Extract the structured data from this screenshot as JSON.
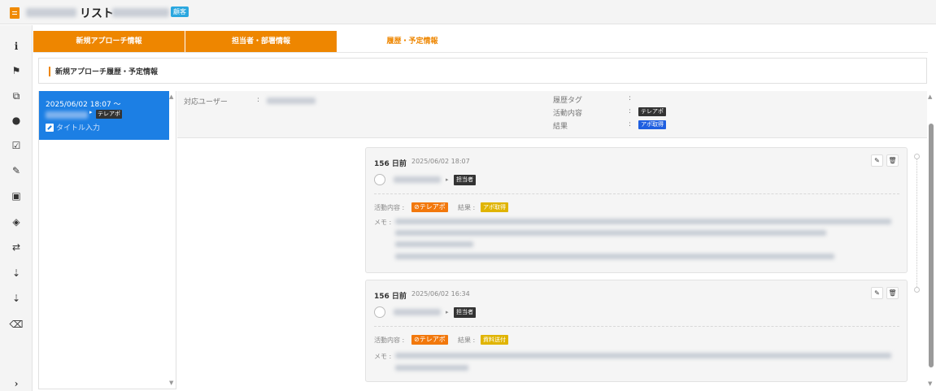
{
  "title": {
    "text": "リスト",
    "badge": "顧客"
  },
  "rail": {
    "icons": [
      "info-icon",
      "flag-icon",
      "copy-icon",
      "chat-icon",
      "checkbox-icon",
      "paperclip-icon",
      "document-icon",
      "eye-off-icon",
      "swap-icon",
      "sort-asc-icon",
      "sort-desc-icon",
      "trash-icon",
      "chevron-right-icon"
    ]
  },
  "tabs": [
    {
      "label": "新規アプローチ情報",
      "active": false
    },
    {
      "label": "担当者・部署情報",
      "active": false
    },
    {
      "label": "履歴・予定情報",
      "active": true
    }
  ],
  "section": {
    "title": "新規アプローチ履歴・予定情報"
  },
  "list": {
    "items": [
      {
        "date": "2025/06/02 18:07 ～",
        "tag": "テレアポ",
        "title_placeholder": "タイトル入力"
      }
    ]
  },
  "info": {
    "user_label": "対応ユーザー",
    "history_tag_label": "履歴タグ",
    "activity_label": "活動内容",
    "activity_value": "テレアポ",
    "result_label": "結果",
    "result_value": "アポ取得",
    "colon": ":"
  },
  "cards": [
    {
      "days": "156 日前",
      "datetime": "2025/06/02 18:07",
      "role": "担当者",
      "activity_label": "活動内容 :",
      "activity_value": "テレアポ",
      "result_label": "結果 :",
      "result_value": "アポ取得",
      "memo_label": "メモ :"
    },
    {
      "days": "156 日前",
      "datetime": "2025/06/02 16:34",
      "role": "担当者",
      "activity_label": "活動内容 :",
      "activity_value": "テレアポ",
      "result_label": "結果 :",
      "result_value": "資料送付",
      "memo_label": "メモ :"
    }
  ],
  "colors": {
    "accent_orange": "#ee8600",
    "selected_blue": "#1c7fe4",
    "tag_dark": "#333333",
    "tag_blue": "#1f5fe0",
    "tag_orange": "#f2780c",
    "tag_yellow": "#e0b400"
  }
}
